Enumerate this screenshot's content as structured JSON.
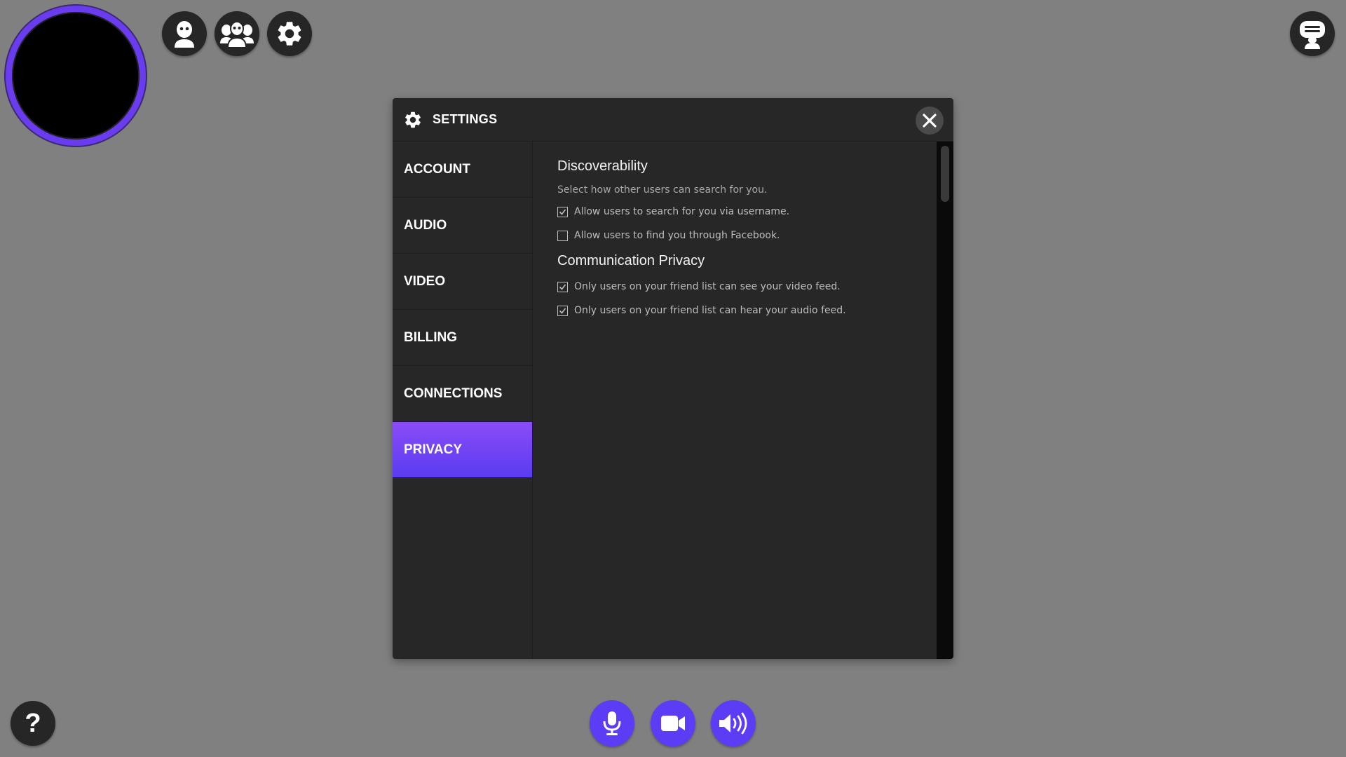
{
  "toolbar": {
    "profile_icon": "user-icon",
    "friends_icon": "friends-icon",
    "settings_icon": "gear-icon",
    "chat_icon": "chat-icon",
    "help_label": "?"
  },
  "settings": {
    "title": "SETTINGS",
    "nav": [
      {
        "label": "ACCOUNT"
      },
      {
        "label": "AUDIO"
      },
      {
        "label": "VIDEO"
      },
      {
        "label": "BILLING"
      },
      {
        "label": "CONNECTIONS"
      },
      {
        "label": "PRIVACY",
        "active": true
      }
    ],
    "discoverability": {
      "title": "Discoverability",
      "description": "Select how other users can search for you.",
      "options": [
        {
          "label": "Allow users to search for you via username.",
          "checked": true
        },
        {
          "label": "Allow users to find you through Facebook.",
          "checked": false
        }
      ]
    },
    "communication": {
      "title": "Communication Privacy",
      "options": [
        {
          "label": "Only users on your friend list can see your video feed.",
          "checked": true
        },
        {
          "label": "Only users on your friend list can hear your audio feed.",
          "checked": true
        }
      ]
    }
  },
  "colors": {
    "accent": "#5c3cf5",
    "active_gradient_top": "#8a4cf7",
    "panel_bg": "#272727",
    "background": "#808080"
  }
}
